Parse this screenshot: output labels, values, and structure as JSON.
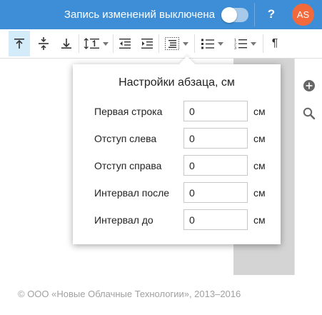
{
  "topbar": {
    "track_changes_label": "Запись изменений выключена",
    "track_changes_on": false,
    "help_label": "?",
    "avatar_initials": "AS",
    "bg_color": "#3d8ed6",
    "avatar_color": "#f26a3c"
  },
  "toolbar": {
    "active_tool": "align-top",
    "tools": [
      "align-top-icon",
      "align-middle-icon",
      "align-bottom-icon",
      "line-spacing-icon",
      "decrease-indent-icon",
      "increase-indent-icon",
      "paragraph-settings-icon",
      "bullet-list-icon",
      "numbered-list-icon",
      "pilcrow-icon"
    ],
    "pilcrow_label": "¶"
  },
  "right_panel": {
    "icons": [
      "add-comment-icon",
      "search-icon"
    ]
  },
  "popup": {
    "title": "Настройки абзаца",
    "title_unit": ", см",
    "rows": [
      {
        "label": "Первая строка",
        "value": "0",
        "unit": "см"
      },
      {
        "label": "Отступ слева",
        "value": "0",
        "unit": "см"
      },
      {
        "label": "Отступ справа",
        "value": "0",
        "unit": "см"
      },
      {
        "label": "Интервал после",
        "value": "0",
        "unit": "см"
      },
      {
        "label": "Интервал до",
        "value": "0",
        "unit": "см"
      }
    ]
  },
  "footer": {
    "copyright": "© ООО «Новые Облачные Технологии», 2013–2016"
  }
}
